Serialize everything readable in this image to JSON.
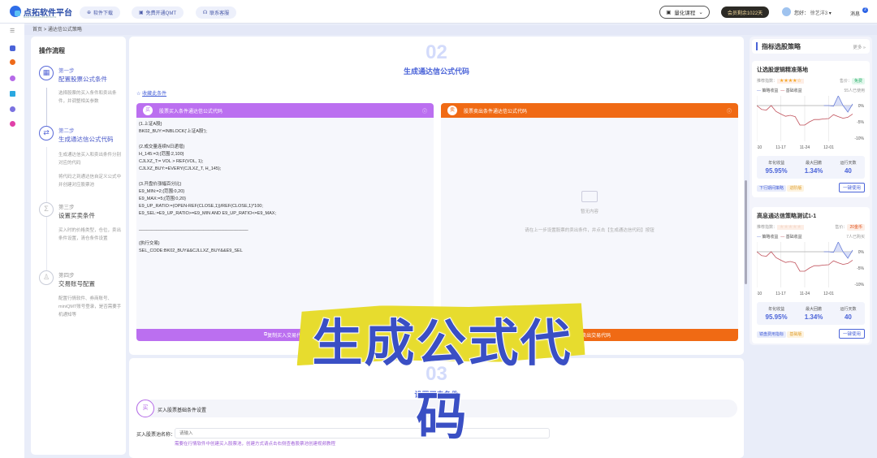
{
  "topbar": {
    "logo": "点拓软件平台",
    "logo_sub": "DIANTUORUANJIANPINGTAI",
    "download": "软件下载",
    "qmt": "免费开通QMT",
    "service": "联系客服",
    "course": "量化课程",
    "membership": "会员剩余1022天",
    "greeting": "您好：",
    "user": "徐艺洋3",
    "messages": "消息",
    "message_count": "2"
  },
  "breadcrumb": {
    "home": "首页",
    "sep": ">",
    "current": "通达信公式策略"
  },
  "flow": {
    "title": "操作流程",
    "steps": [
      {
        "num": "第一步",
        "title": "配置股票公式条件",
        "desc": "选择股票的买入条件和卖出条件，并调整相关参数"
      },
      {
        "num": "第二步",
        "title": "生成通达信公式代码",
        "desc": "生成通达信买入和卖出条件分别对应的代码",
        "desc2": "将代码之到通达信自定义公式中并创建对应股票池"
      },
      {
        "num": "第三步",
        "title": "设置买卖条件",
        "desc": "买入时的价格类型，仓位，卖出条件设置，清仓条件设置"
      },
      {
        "num": "第四步",
        "title": "交易账号配置",
        "desc": "配置行情软件、券商账号、miniQMT账号登录，是否需要手机通知等"
      }
    ]
  },
  "section2": {
    "num": "02",
    "title": "生成通达信公式代码",
    "favorite": "收藏此条件",
    "buy": {
      "icon": "买",
      "title": "股票买入条件通达信公式代码",
      "code": "{1.上证A股}\nBK02_BUY:=INBLOCK('上证A股');\n\n{2.成交量连续N日递增}\nH_145:=3;{范围:2,100}\nCJLXZ_T:= VOL > REF(VOL, 1);\nCJLXZ_BUY:=EVERY(CJLXZ_T, H_145);\n\n{3.开盘价涨幅百分比}\nE9_MIN:=2;{范围:0,20}\nE9_MAX:=5;{范围:0,20}\nE9_UP_RATIO:=(OPEN-REF(CLOSE,1))/REF(CLOSE,1)*100;\nE9_SEL:=E9_UP_RATIO>=E9_MIN AND E9_UP_RATIO<=E9_MAX;\n\n____________________________________________\n\n{执行交易}\nSEL_CODE:BK02_BUY&&CJLLXZ_BUY&&E9_SEL",
      "copy": "复制买入交易代码"
    },
    "sell": {
      "icon": "卖",
      "title": "股票卖出条件通达信公式代码",
      "empty": "暂无内容",
      "hint": "请在上一步设置股票的卖出条件，并点击【生成通达信代码】按钮",
      "copy": "复制卖出交易代码"
    }
  },
  "overlay": "生成公式代码",
  "section3": {
    "num": "03",
    "title": "设置买卖条件",
    "buy_icon": "买",
    "buy_title": "买入股票基础条件设置",
    "pool_label": "买入股票池名称：",
    "pool_placeholder": "请输入",
    "pool_hint": "需要在行情软件中创建买入股票池，创建方式请点击右侧查看股票池创建视频教程"
  },
  "strategies": {
    "title": "指标选股策略",
    "more": "更多 »",
    "items": [
      {
        "name": "让选股逻辑精准落地",
        "rating_label": "推荐指数：",
        "stars": "★★★★☆",
        "rating": 3.5,
        "price_label": "售价：",
        "price": "免费",
        "legend_strategy": "策略收益",
        "legend_base": "基础收益",
        "users": "55人已使用",
        "x_ticks": [
          "11-10",
          "11-17",
          "11-24",
          "12-01"
        ],
        "y_ticks": [
          "0%",
          "-5%",
          "-10%"
        ],
        "ann_label": "年化收益",
        "ann": "95.95%",
        "dd_label": "最大回撤",
        "dd": "1.34%",
        "days_label": "运行天数",
        "days": "40",
        "tag1": "下行期间策略",
        "tag2": "进阶版",
        "use": "一键使用"
      },
      {
        "name": "高息通达信策略测试1-1",
        "rating_label": "推荐指数：",
        "stars": "★★★★★",
        "rating": 0,
        "price_label": "售价：",
        "price": "20金币",
        "legend_strategy": "策略收益",
        "legend_base": "基础收益",
        "users": "7人已购买",
        "x_ticks": [
          "11-10",
          "11-17",
          "11-24",
          "12-01"
        ],
        "y_ticks": [
          "0%",
          "-5%",
          "-10%"
        ],
        "ann_label": "年化收益",
        "ann": "95.95%",
        "dd_label": "最大回撤",
        "dd": "1.34%",
        "days_label": "运行天数",
        "days": "40",
        "tag1": "镜盘费用指标",
        "tag2": "基础版",
        "use": "一键使用"
      }
    ]
  },
  "chart_data": {
    "type": "line",
    "ylim": [
      -11,
      3
    ],
    "base": [
      0,
      -1.2,
      -1.4,
      0,
      -1.8,
      -2.6,
      -3.3,
      -3,
      -3.4,
      -6,
      -6,
      -5,
      -4.3,
      -4.3,
      -4.1,
      -4,
      -2.8,
      -3.4,
      -3.9,
      -3.6,
      -2.6
    ],
    "strategy_start": 14,
    "strategy": [
      0,
      0,
      -0.2,
      3,
      0,
      -2,
      0.5
    ],
    "colors": {
      "strategy": "#6b7fd8",
      "base": "#c0505a"
    }
  }
}
